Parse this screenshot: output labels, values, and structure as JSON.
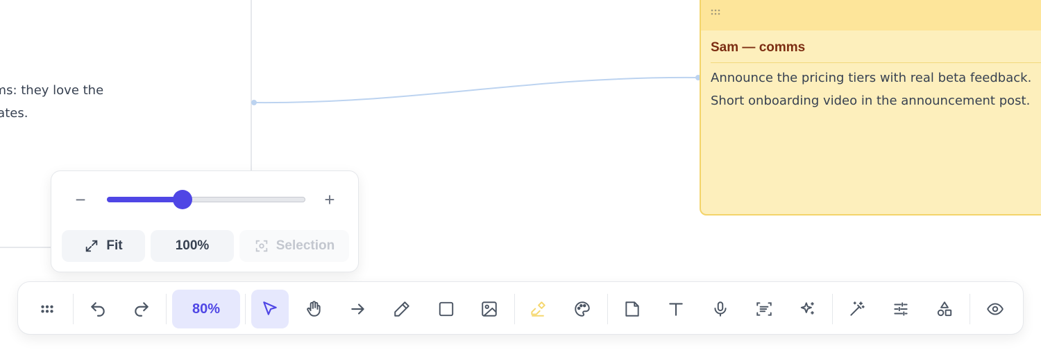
{
  "left_note": {
    "line1": "Our first five teams: they love the",
    "line2": "onboarding took too long for new teammates."
  },
  "right_note": {
    "title": "Sam — comms",
    "lines": [
      "Announce the pricing tiers with real beta feedback.",
      "Short onboarding video in the announcement post."
    ]
  },
  "zoom_panel": {
    "minus": "−",
    "plus": "+",
    "slider_value_fraction": 0.38,
    "fit_label": "Fit",
    "reset_label": "100%",
    "selection_label": "Selection"
  },
  "toolbar": {
    "zoom_label": "80%",
    "tools": [
      "drag-handle",
      "undo",
      "redo",
      "select",
      "hand",
      "arrow",
      "pen",
      "rectangle",
      "image",
      "highlighter",
      "palette",
      "sticky-note",
      "text",
      "microphone",
      "scan-text",
      "sparkles",
      "magic-wand",
      "sliders",
      "shapes",
      "eye"
    ]
  },
  "colors": {
    "accent": "#4f46e5",
    "sticky_yellow": "#fdefbc",
    "connector": "#bcd3f0",
    "highlighter": "#f5d76e"
  }
}
